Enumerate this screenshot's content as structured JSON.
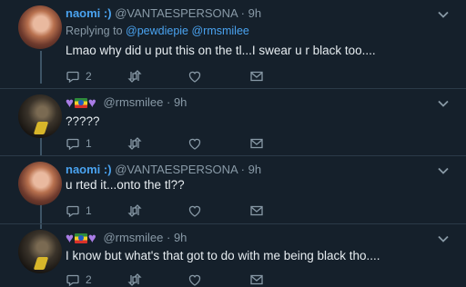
{
  "icons": {
    "reply": "reply-icon",
    "retweet": "retweet-icon",
    "like": "heart-icon",
    "dm": "envelope-icon",
    "menu": "chevron-down-icon"
  },
  "colors": {
    "background": "#15202b",
    "link": "#4aa3f0",
    "muted": "#8899a6"
  },
  "tweets": [
    {
      "name": "naomi :)",
      "handle": "@VANTAESPERSONA",
      "dot": "·",
      "time": "9h",
      "replying_prefix": "Replying to ",
      "replying_mentions": "@pewdiepie @rmsmilee",
      "text": "Lmao why did u put this on the tl...I swear u r black too....",
      "reply_count": "2"
    },
    {
      "handle": "@rmsmilee",
      "dot": "·",
      "time": "9h",
      "text": "?????",
      "reply_count": "1"
    },
    {
      "name": "naomi :)",
      "handle": "@VANTAESPERSONA",
      "dot": "·",
      "time": "9h",
      "text": "u rted it...onto the tl??",
      "reply_count": "1"
    },
    {
      "handle": "@rmsmilee",
      "dot": "·",
      "time": "9h",
      "text": "I know but what's that got to do with me being black tho....",
      "reply_count": "2"
    }
  ]
}
